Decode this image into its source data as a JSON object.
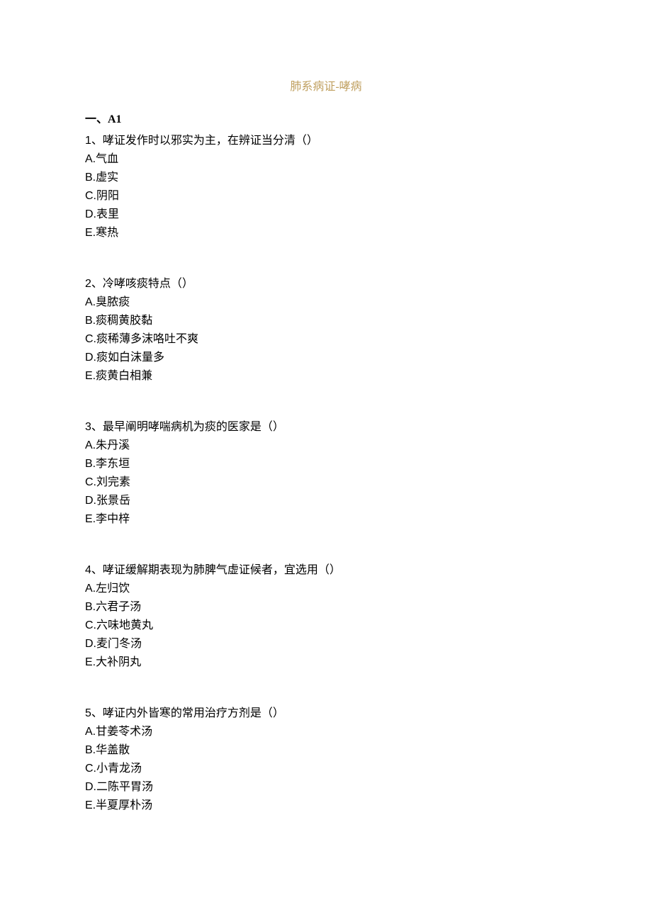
{
  "title": "肺系病证-哮病",
  "section_header": "一、A1",
  "questions": [
    {
      "number": "1",
      "text": "、哮证发作时以邪实为主，在辨证当分清（）",
      "options": [
        {
          "letter": "A.",
          "text": "气血"
        },
        {
          "letter": "B.",
          "text": "虚实"
        },
        {
          "letter": "C.",
          "text": "阴阳"
        },
        {
          "letter": "D.",
          "text": "表里"
        },
        {
          "letter": "E.",
          "text": "寒热"
        }
      ]
    },
    {
      "number": "2",
      "text": "、冷哮咳痰特点（）",
      "options": [
        {
          "letter": "A.",
          "text": "臭脓痰"
        },
        {
          "letter": "B.",
          "text": "痰稠黄胶黏"
        },
        {
          "letter": "C.",
          "text": "痰稀薄多沫咯吐不爽"
        },
        {
          "letter": "D.",
          "text": "痰如白沫量多"
        },
        {
          "letter": "E.",
          "text": "痰黄白相兼"
        }
      ]
    },
    {
      "number": "3",
      "text": "、最早阐明哮喘病机为痰的医家是（）",
      "options": [
        {
          "letter": "A.",
          "text": "朱丹溪"
        },
        {
          "letter": "B.",
          "text": "李东垣"
        },
        {
          "letter": "C.",
          "text": "刘完素"
        },
        {
          "letter": "D.",
          "text": "张景岳"
        },
        {
          "letter": "E.",
          "text": "李中梓"
        }
      ]
    },
    {
      "number": "4",
      "text": "、哮证缓解期表现为肺脾气虚证候者，宜选用（）",
      "options": [
        {
          "letter": "A.",
          "text": "左归饮"
        },
        {
          "letter": "B.",
          "text": "六君子汤"
        },
        {
          "letter": "C.",
          "text": "六味地黄丸"
        },
        {
          "letter": "D.",
          "text": "麦门冬汤"
        },
        {
          "letter": "E.",
          "text": "大补阴丸"
        }
      ]
    },
    {
      "number": "5",
      "text": "、哮证内外皆寒的常用治疗方剂是（）",
      "options": [
        {
          "letter": "A.",
          "text": "甘姜苓术汤"
        },
        {
          "letter": "B.",
          "text": "华盖散"
        },
        {
          "letter": "C.",
          "text": "小青龙汤"
        },
        {
          "letter": "D.",
          "text": "二陈平胃汤"
        },
        {
          "letter": "E.",
          "text": "半夏厚朴汤"
        }
      ]
    }
  ]
}
